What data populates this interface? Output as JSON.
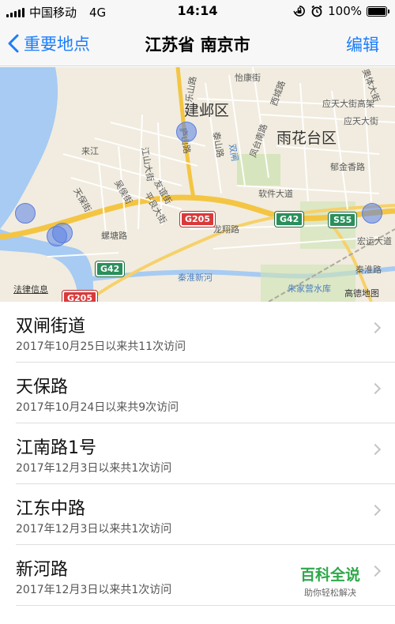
{
  "status_bar": {
    "carrier": "中国移动",
    "network": "4G",
    "time": "14:14",
    "battery_text": "100%",
    "battery_level": 1.0,
    "icons": [
      "rotation-lock-icon",
      "alarm-icon"
    ]
  },
  "nav": {
    "back_label": "重要地点",
    "title": "江苏省 南京市",
    "edit_label": "编辑"
  },
  "map": {
    "districts": [
      "建邺区",
      "雨花台区"
    ],
    "places": [
      "怡康街",
      "应天大街高架",
      "乐山路",
      "西城路",
      "应天大街",
      "凤台南路",
      "奥体大街",
      "江山大街",
      "庐山路",
      "泰山路",
      "双闸",
      "友谊街",
      "平良大街",
      "吴侯街",
      "天保街",
      "软件大道",
      "郁金香路",
      "龙翔路",
      "螺塘路",
      "宏运大道",
      "秦淮新河",
      "秦淮路",
      "朱家营水库",
      "来江"
    ],
    "roads": [
      "G205",
      "G42",
      "S55",
      "G42",
      "G205"
    ],
    "attribution_left": "法律信息",
    "attribution_right": "高德地图",
    "water_color": "#a7cbf2",
    "land_color": "#f1ecdf"
  },
  "places": [
    {
      "name": "双闸街道",
      "detail": "2017年10月25日以来共11次访问"
    },
    {
      "name": "天保路",
      "detail": "2017年10月24日以来共9次访问"
    },
    {
      "name": "江南路1号",
      "detail": "2017年12月3日以来共1次访问"
    },
    {
      "name": "江东中路",
      "detail": "2017年12月3日以来共1次访问"
    },
    {
      "name": "新河路",
      "detail": "2017年12月3日以来共1次访问"
    }
  ],
  "watermark": {
    "title": "百科全说",
    "subtitle": "助你轻松解决"
  },
  "accent_color": "#1a7dfb"
}
